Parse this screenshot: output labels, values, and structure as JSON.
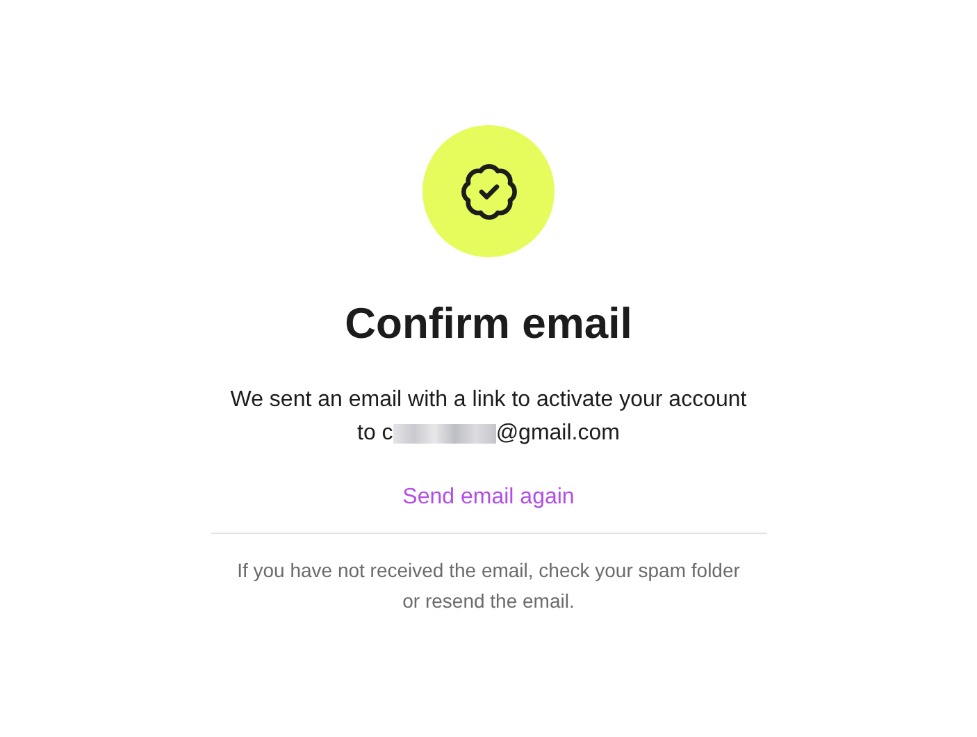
{
  "title": "Confirm email",
  "message": "We sent an email with a link to activate your account",
  "recipient": {
    "prefix": "to c",
    "domain": "@gmail.com",
    "redacted": true
  },
  "resend_link": "Send email again",
  "note": "If you have not received the email, check your spam folder or resend the email."
}
